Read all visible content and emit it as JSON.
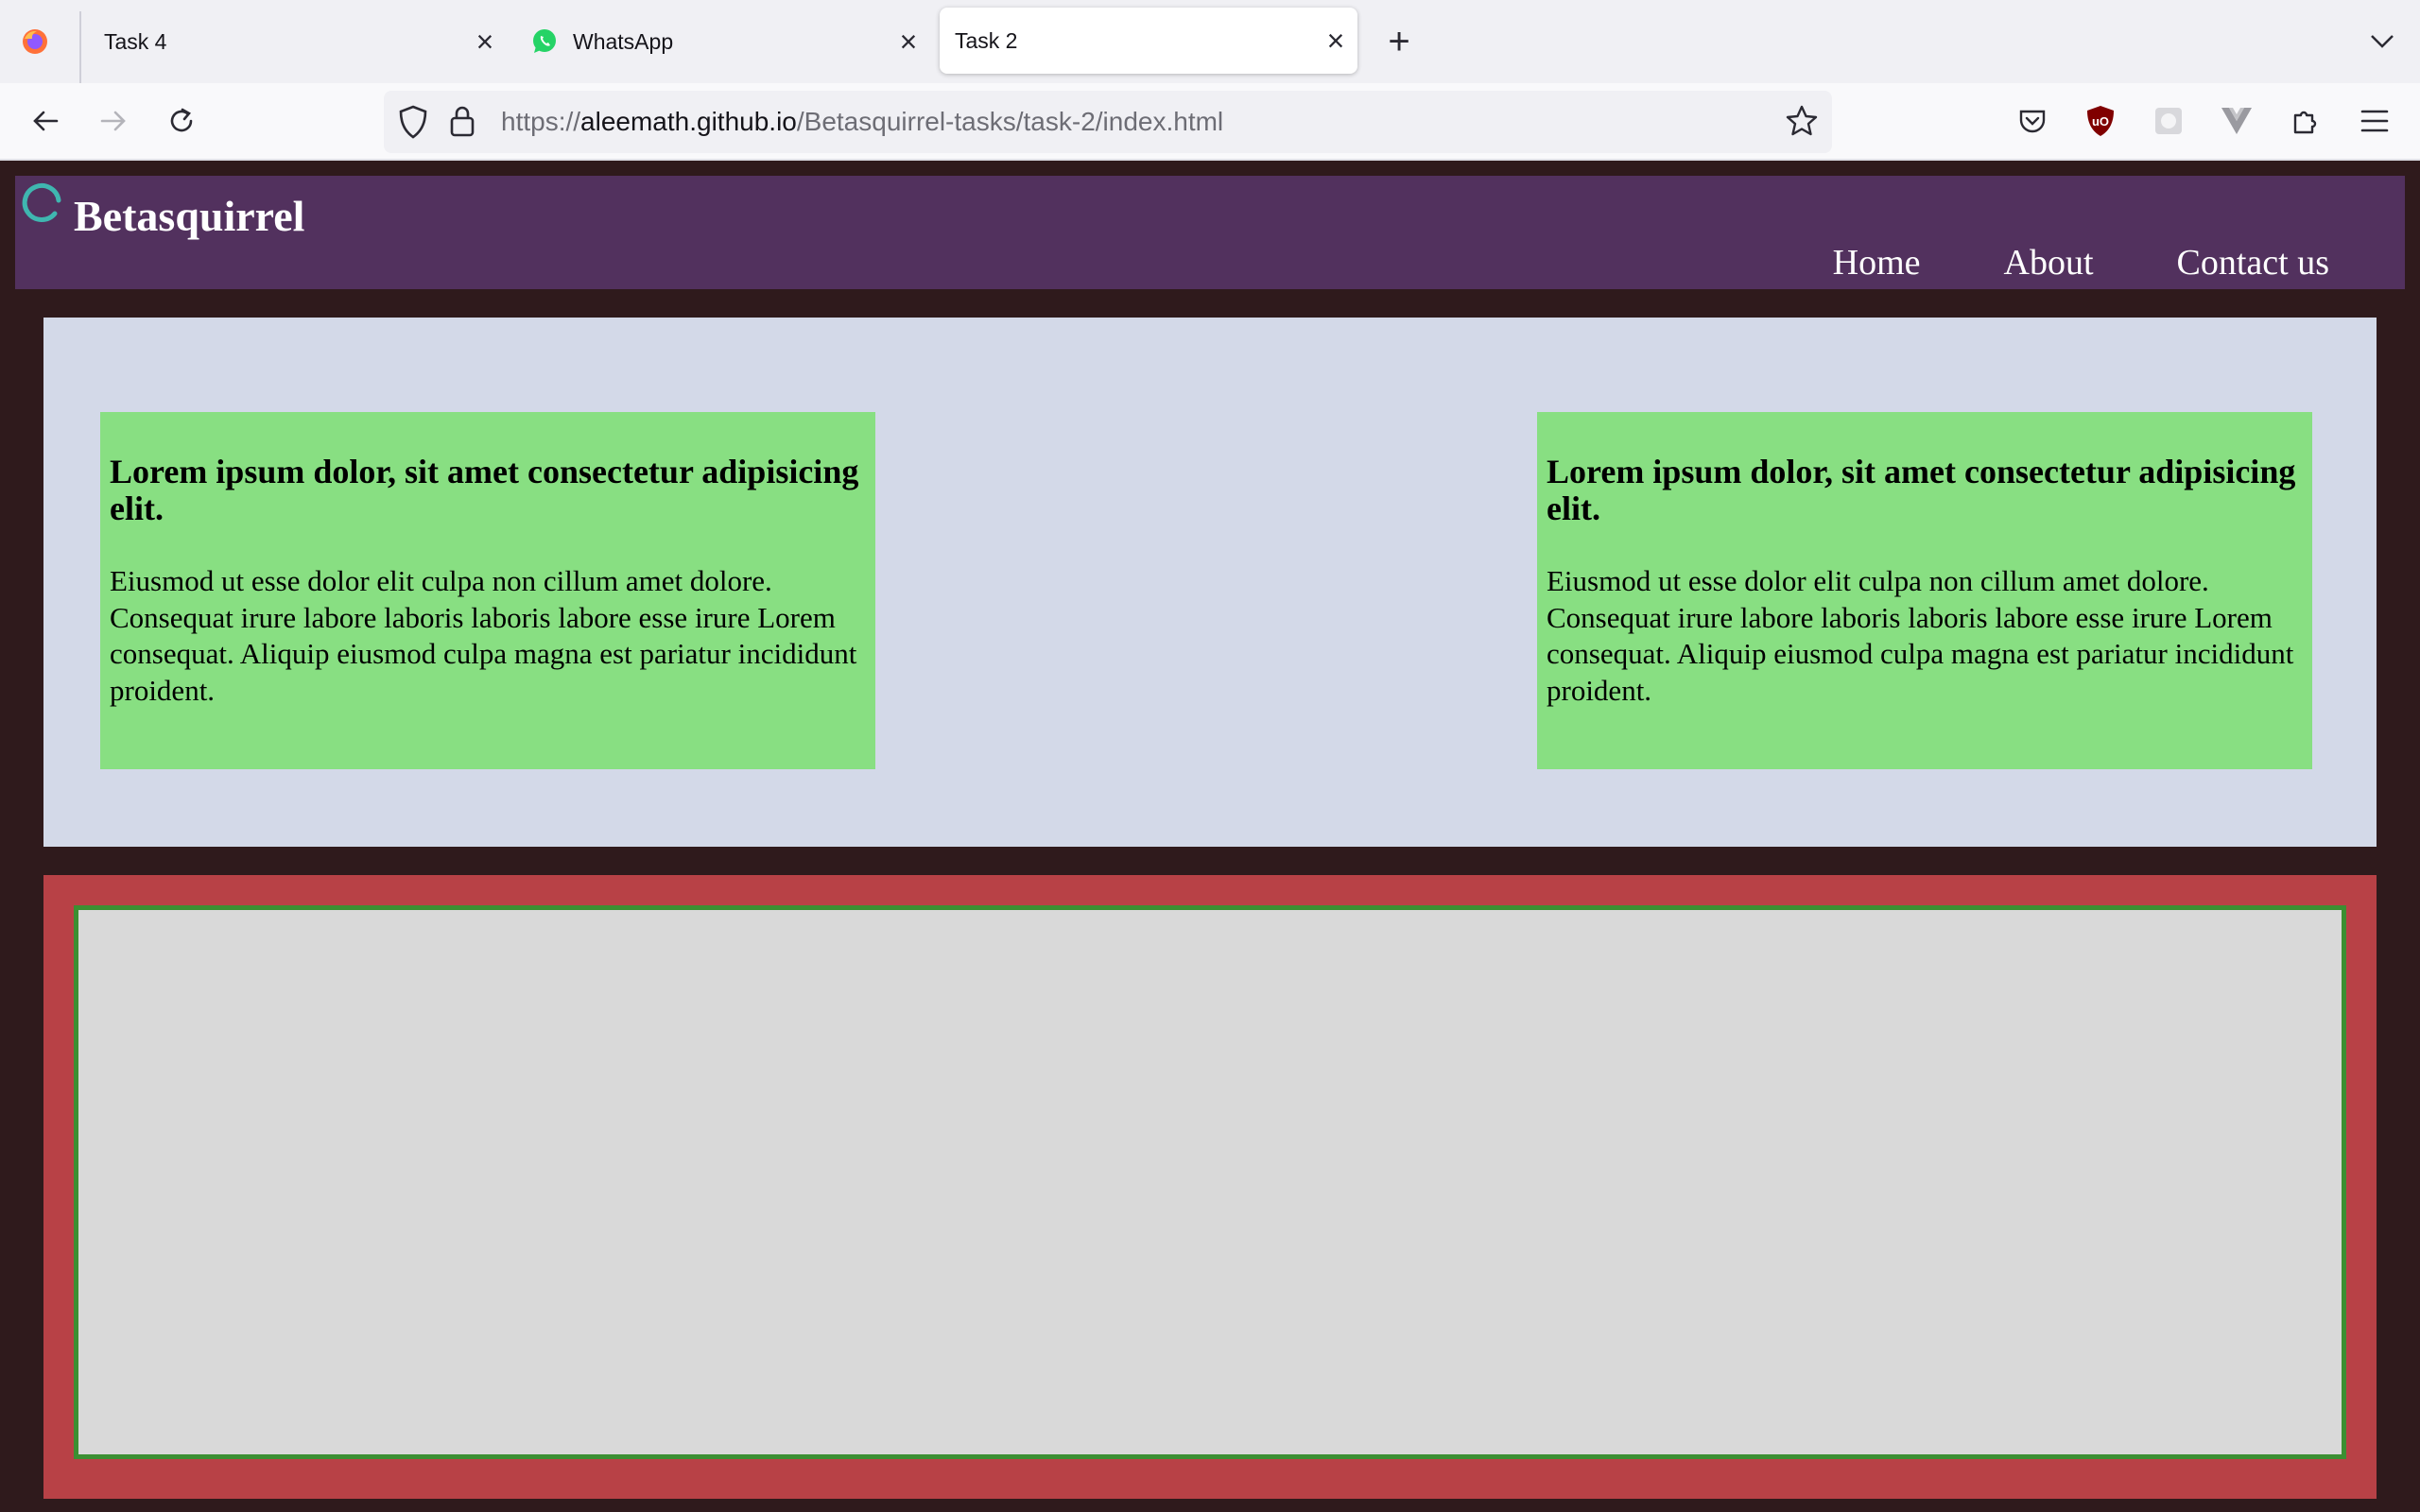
{
  "browser": {
    "tabs": [
      {
        "title": "Task 4",
        "active": false
      },
      {
        "title": "WhatsApp",
        "active": false
      },
      {
        "title": "Task 2",
        "active": true
      }
    ],
    "url": {
      "scheme": "https://",
      "host": "aleemath.github.io",
      "path": "/Betasquirrel-tasks/task-2/index.html"
    },
    "toolbar_icons": [
      "back-icon",
      "forward-icon",
      "reload-icon",
      "shield-icon",
      "lock-icon",
      "bookmark-star-icon",
      "pocket-icon",
      "ublock-icon",
      "extension-grey-icon",
      "vue-devtools-icon",
      "extensions-puzzle-icon",
      "hamburger-menu-icon"
    ]
  },
  "site": {
    "brand": "Betasquirrel",
    "nav": [
      "Home",
      "About",
      "Contact us"
    ],
    "cards": [
      {
        "heading": "Lorem ipsum dolor, sit amet consectetur adipisicing elit.",
        "body": "Eiusmod ut esse dolor elit culpa non cillum amet dolore. Consequat irure labore laboris laboris labore esse irure Lorem consequat. Aliquip eiusmod culpa magna est pariatur incididunt proident."
      },
      {
        "heading": "Lorem ipsum dolor, sit amet consectetur adipisicing elit.",
        "body": "Eiusmod ut esse dolor elit culpa non cillum amet dolore. Consequat irure labore laboris laboris labore esse irure Lorem consequat. Aliquip eiusmod culpa magna est pariatur incididunt proident."
      }
    ]
  },
  "colors": {
    "page_bg": "#2f1a1c",
    "header_bg": "#52315e",
    "cards_section_bg": "#d3d9e8",
    "card_bg": "#88df82",
    "bottom_section_bg": "#b84146",
    "inner_box_bg": "#d9d9d9",
    "inner_box_border": "#3b8f32"
  }
}
